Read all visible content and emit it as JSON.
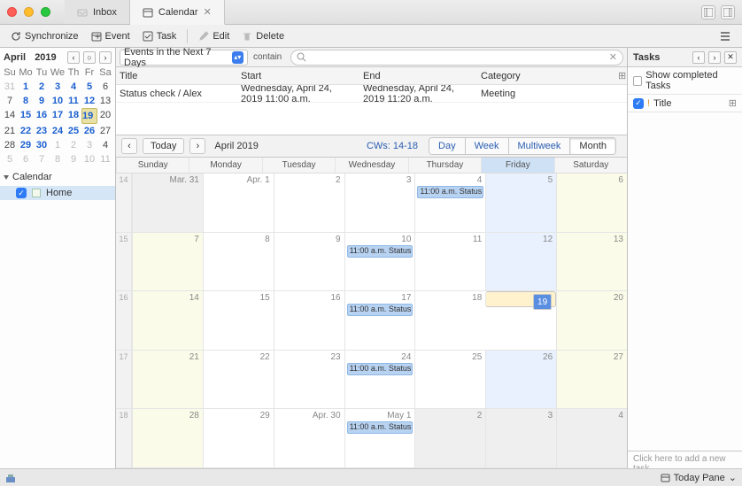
{
  "tabs": {
    "inbox": "Inbox",
    "calendar": "Calendar"
  },
  "toolbar": {
    "sync": "Synchronize",
    "event": "Event",
    "task": "Task",
    "edit": "Edit",
    "delete": "Delete"
  },
  "mini": {
    "month": "April",
    "year": "2019",
    "dh": [
      "Su",
      "Mo",
      "Tu",
      "We",
      "Th",
      "Fr",
      "Sa"
    ],
    "rows": [
      [
        {
          "n": "31",
          "out": 1
        },
        {
          "n": "1",
          "b": 1
        },
        {
          "n": "2",
          "b": 1
        },
        {
          "n": "3",
          "b": 1
        },
        {
          "n": "4",
          "b": 1
        },
        {
          "n": "5",
          "b": 1
        },
        {
          "n": "6"
        }
      ],
      [
        {
          "n": "7"
        },
        {
          "n": "8",
          "b": 1
        },
        {
          "n": "9",
          "b": 1
        },
        {
          "n": "10",
          "b": 1
        },
        {
          "n": "11",
          "b": 1
        },
        {
          "n": "12",
          "b": 1
        },
        {
          "n": "13"
        }
      ],
      [
        {
          "n": "14"
        },
        {
          "n": "15",
          "b": 1
        },
        {
          "n": "16",
          "b": 1
        },
        {
          "n": "17",
          "b": 1
        },
        {
          "n": "18",
          "b": 1
        },
        {
          "n": "19",
          "b": 1,
          "t": 1
        },
        {
          "n": "20"
        }
      ],
      [
        {
          "n": "21"
        },
        {
          "n": "22",
          "b": 1
        },
        {
          "n": "23",
          "b": 1
        },
        {
          "n": "24",
          "b": 1
        },
        {
          "n": "25",
          "b": 1
        },
        {
          "n": "26",
          "b": 1
        },
        {
          "n": "27"
        }
      ],
      [
        {
          "n": "28"
        },
        {
          "n": "29",
          "b": 1
        },
        {
          "n": "30",
          "b": 1
        },
        {
          "n": "1",
          "out": 1
        },
        {
          "n": "2",
          "out": 1
        },
        {
          "n": "3",
          "out": 1
        },
        {
          "n": "4"
        }
      ],
      [
        {
          "n": "5",
          "out": 1
        },
        {
          "n": "6",
          "out": 1
        },
        {
          "n": "7",
          "out": 1
        },
        {
          "n": "8",
          "out": 1
        },
        {
          "n": "9",
          "out": 1
        },
        {
          "n": "10",
          "out": 1
        },
        {
          "n": "11",
          "out": 1
        }
      ]
    ]
  },
  "sidebar": {
    "section": "Calendar",
    "cal0": "Home"
  },
  "filter": {
    "scope": "Events in the Next 7 Days",
    "op": "contain",
    "ph": ""
  },
  "list": {
    "hdr": {
      "title": "Title",
      "start": "Start",
      "end": "End",
      "cat": "Category"
    },
    "rows": [
      {
        "title": "Status check / Alex",
        "start": "Wednesday, April 24, 2019 11:00 a.m.",
        "end": "Wednesday, April 24, 2019 11:20 a.m.",
        "cat": "Meeting"
      }
    ]
  },
  "calnav": {
    "today": "Today",
    "label": "April 2019",
    "cw": "CWs: 14-18",
    "views": {
      "day": "Day",
      "week": "Week",
      "multi": "Multiweek",
      "month": "Month"
    }
  },
  "days": [
    "Sunday",
    "Monday",
    "Tuesday",
    "Wednesday",
    "Thursday",
    "Friday",
    "Saturday"
  ],
  "weeks": [
    {
      "wk": "14",
      "cells": [
        {
          "dn": "Mar. 31",
          "grey": 1
        },
        {
          "dn": "Apr. 1"
        },
        {
          "dn": "2"
        },
        {
          "dn": "3"
        },
        {
          "dn": "4",
          "ev": "11:00 a.m. Status ..."
        },
        {
          "dn": "5",
          "hl": 1
        },
        {
          "dn": "6",
          "cream": 1
        }
      ]
    },
    {
      "wk": "15",
      "cells": [
        {
          "dn": "7",
          "cream": 1
        },
        {
          "dn": "8"
        },
        {
          "dn": "9"
        },
        {
          "dn": "10",
          "ev": "11:00 a.m. Status ..."
        },
        {
          "dn": "11"
        },
        {
          "dn": "12",
          "hl": 1
        },
        {
          "dn": "13",
          "cream": 1
        }
      ]
    },
    {
      "wk": "16",
      "cells": [
        {
          "dn": "14",
          "cream": 1
        },
        {
          "dn": "15"
        },
        {
          "dn": "16"
        },
        {
          "dn": "17",
          "ev": "11:00 a.m. Status ..."
        },
        {
          "dn": "18"
        },
        {
          "dn": "19",
          "today": 1
        },
        {
          "dn": "20",
          "cream": 1
        }
      ]
    },
    {
      "wk": "17",
      "cells": [
        {
          "dn": "21",
          "cream": 1
        },
        {
          "dn": "22"
        },
        {
          "dn": "23"
        },
        {
          "dn": "24",
          "ev": "11:00 a.m. Status ..."
        },
        {
          "dn": "25"
        },
        {
          "dn": "26",
          "hl": 1
        },
        {
          "dn": "27",
          "cream": 1
        }
      ]
    },
    {
      "wk": "18",
      "cells": [
        {
          "dn": "28",
          "cream": 1
        },
        {
          "dn": "29"
        },
        {
          "dn": "Apr. 30"
        },
        {
          "dn": "May 1",
          "ev": "11:00 a.m. Status ..."
        },
        {
          "dn": "2",
          "grey": 1
        },
        {
          "dn": "3",
          "grey": 1
        },
        {
          "dn": "4",
          "grey": 1
        }
      ]
    }
  ],
  "taskpane": {
    "title": "Tasks",
    "show": "Show completed Tasks",
    "col": "Title",
    "add": "Click here to add a new task"
  },
  "status": {
    "today": "Today Pane"
  }
}
